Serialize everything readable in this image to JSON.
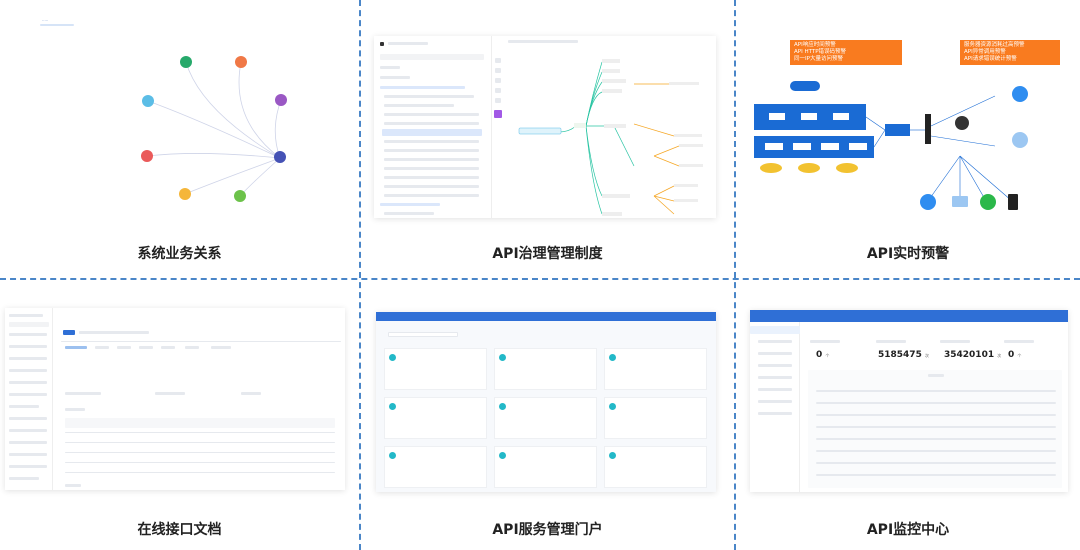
{
  "captions": {
    "c1": "系统业务关系",
    "c2": "API治理管理制度",
    "c3": "API实时预警",
    "c4": "在线接口文档",
    "c5": "API服务管理门户",
    "c6": "API监控中心"
  },
  "alert": {
    "left_items": [
      "API响应时间预警",
      "API HTTP错误码预警",
      "同一IP大量访问预警"
    ],
    "right_items": [
      "服务器资源消耗过高预警",
      "API异常调用预警",
      "API请求错误统计预警"
    ]
  },
  "monitor": {
    "stats": [
      {
        "value": "0",
        "unit": "个"
      },
      {
        "value": "5185475",
        "unit": "次"
      },
      {
        "value": "35420101",
        "unit": "次"
      },
      {
        "value": "0",
        "unit": "个"
      }
    ]
  },
  "colors": {
    "divider": "#4a86c8",
    "accent_blue": "#2f6fd6",
    "alert_orange": "#f97b1f"
  }
}
